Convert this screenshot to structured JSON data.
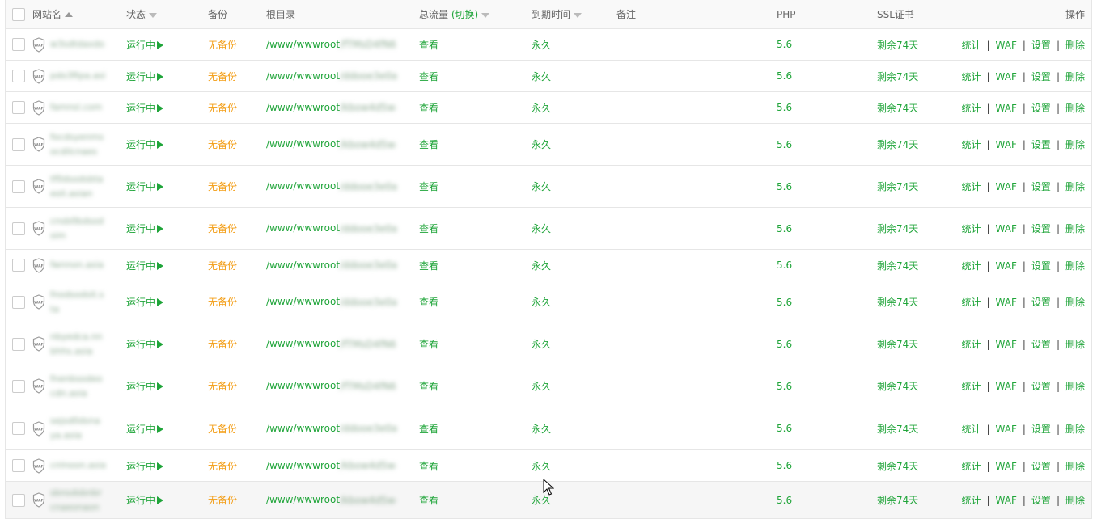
{
  "header": {
    "site_name": "网站名",
    "status": "状态",
    "backup": "备份",
    "root_dir": "根目录",
    "total_flow": "总流量",
    "switch_label": "(切换)",
    "expire": "到期时间",
    "note": "备注",
    "php": "PHP",
    "ssl": "SSL证书",
    "ops": "操作"
  },
  "colors": {
    "accent": "#20a53a",
    "warning": "#f39c12"
  },
  "rows": [
    {
      "name": "w3sdtdaxdo.com",
      "status": "运行中",
      "backup": "无备份",
      "path_prefix": "/www/wwwroot",
      "path_rest": "/fTMsD4fN6ws",
      "flow": "查看",
      "expire": "永久",
      "note": "",
      "php": "5.6",
      "ssl": "剩余74天",
      "op_stats": "统计",
      "op_waf": "WAF",
      "op_settings": "设置",
      "op_delete": "删除"
    },
    {
      "name": "pdo3ftpa.asia",
      "status": "运行中",
      "backup": "无备份",
      "path_prefix": "/www/wwwroot",
      "path_rest": "/ddooe3e0a.ia",
      "flow": "查看",
      "expire": "永久",
      "note": "",
      "php": "5.6",
      "ssl": "剩余74天",
      "op_stats": "统计",
      "op_waf": "WAF",
      "op_settings": "设置",
      "op_delete": "删除"
    },
    {
      "name": "famnsl.com",
      "status": "运行中",
      "backup": "无备份",
      "path_prefix": "/www/wwwroot",
      "path_rest": "/kbow4d5w4d.w",
      "flow": "查看",
      "expire": "永久",
      "note": "",
      "php": "5.6",
      "ssl": "剩余74天",
      "op_stats": "统计",
      "op_waf": "WAF",
      "op_settings": "设置",
      "op_delete": "删除"
    },
    {
      "name": "focdsyenmsocdilcnaes",
      "status": "运行中",
      "backup": "无备份",
      "path_prefix": "/www/wwwroot",
      "path_rest": "/kbow4d5w4d.w",
      "flow": "查看",
      "expire": "永久",
      "note": "",
      "php": "5.6",
      "ssl": "剩余74天",
      "op_stats": "统计",
      "op_waf": "WAF",
      "op_settings": "设置",
      "op_delete": "删除"
    },
    {
      "name": "tf0dsodsbtaeoli.asian",
      "status": "运行中",
      "backup": "无备份",
      "path_prefix": "/www/wwwroot",
      "path_rest": "/ddooe3e0a.ia",
      "flow": "查看",
      "expire": "永久",
      "note": "",
      "php": "5.6",
      "ssl": "剩余74天",
      "op_stats": "统计",
      "op_waf": "WAF",
      "op_settings": "设置",
      "op_delete": "删除"
    },
    {
      "name": "cnsb0bdsodsim",
      "status": "运行中",
      "backup": "无备份",
      "path_prefix": "/www/wwwroot",
      "path_rest": "/ddooe3e0a.ia",
      "flow": "查看",
      "expire": "永久",
      "note": "",
      "php": "5.6",
      "ssl": "剩余74天",
      "op_stats": "统计",
      "op_waf": "WAF",
      "op_settings": "设置",
      "op_delete": "删除"
    },
    {
      "name": "fwnnon.asia",
      "status": "运行中",
      "backup": "无备份",
      "path_prefix": "/www/wwwroot",
      "path_rest": "/ddooe3e0a.ia",
      "flow": "查看",
      "expire": "永久",
      "note": "",
      "php": "5.6",
      "ssl": "剩余74天",
      "op_stats": "统计",
      "op_waf": "WAF",
      "op_settings": "设置",
      "op_delete": "删除"
    },
    {
      "name": "fnodsodsit.sta",
      "status": "运行中",
      "backup": "无备份",
      "path_prefix": "/www/wwwroot",
      "path_rest": "/ddooe3e0a.ia",
      "flow": "查看",
      "expire": "永久",
      "note": "",
      "php": "5.6",
      "ssl": "剩余74天",
      "op_stats": "统计",
      "op_waf": "WAF",
      "op_settings": "设置",
      "op_delete": "删除"
    },
    {
      "name": "nbyedca.nnbhhs.asia",
      "status": "运行中",
      "backup": "无备份",
      "path_prefix": "/www/wwwroot",
      "path_rest": "/fTMsD4fN6ws",
      "flow": "查看",
      "expire": "永久",
      "note": "",
      "php": "5.6",
      "ssl": "剩余74天",
      "op_stats": "统计",
      "op_waf": "WAF",
      "op_settings": "设置",
      "op_delete": "删除"
    },
    {
      "name": "fnenbsodeocdn.asia",
      "status": "运行中",
      "backup": "无备份",
      "path_prefix": "/www/wwwroot",
      "path_rest": "/fTMsD4fN6ws",
      "flow": "查看",
      "expire": "永久",
      "note": "",
      "php": "5.6",
      "ssl": "剩余74天",
      "op_stats": "统计",
      "op_waf": "WAF",
      "op_settings": "设置",
      "op_delete": "删除"
    },
    {
      "name": "sejsd0dsnaya.asia",
      "status": "运行中",
      "backup": "无备份",
      "path_prefix": "/www/wwwroot",
      "path_rest": "/ddooe3e0a.ia",
      "flow": "查看",
      "expire": "永久",
      "note": "",
      "php": "5.6",
      "ssl": "剩余74天",
      "op_stats": "统计",
      "op_waf": "WAF",
      "op_settings": "设置",
      "op_delete": "删除"
    },
    {
      "name": "cnlnoon.asia",
      "status": "运行中",
      "backup": "无备份",
      "path_prefix": "/www/wwwroot",
      "path_rest": "/kbow4d5w4d.w",
      "flow": "查看",
      "expire": "永久",
      "note": "",
      "php": "5.6",
      "ssl": "剩余74天",
      "op_stats": "统计",
      "op_waf": "WAF",
      "op_settings": "设置",
      "op_delete": "删除"
    },
    {
      "name": "sbnsdsbnbrcnaeonaon",
      "status": "运行中",
      "backup": "无备份",
      "path_prefix": "/www/wwwroot",
      "path_rest": "/kbow4d5w4d.w",
      "flow": "查看",
      "expire": "永久",
      "note": "",
      "php": "5.6",
      "ssl": "剩余74天",
      "op_stats": "统计",
      "op_waf": "WAF",
      "op_settings": "设置",
      "op_delete": "删除"
    }
  ]
}
